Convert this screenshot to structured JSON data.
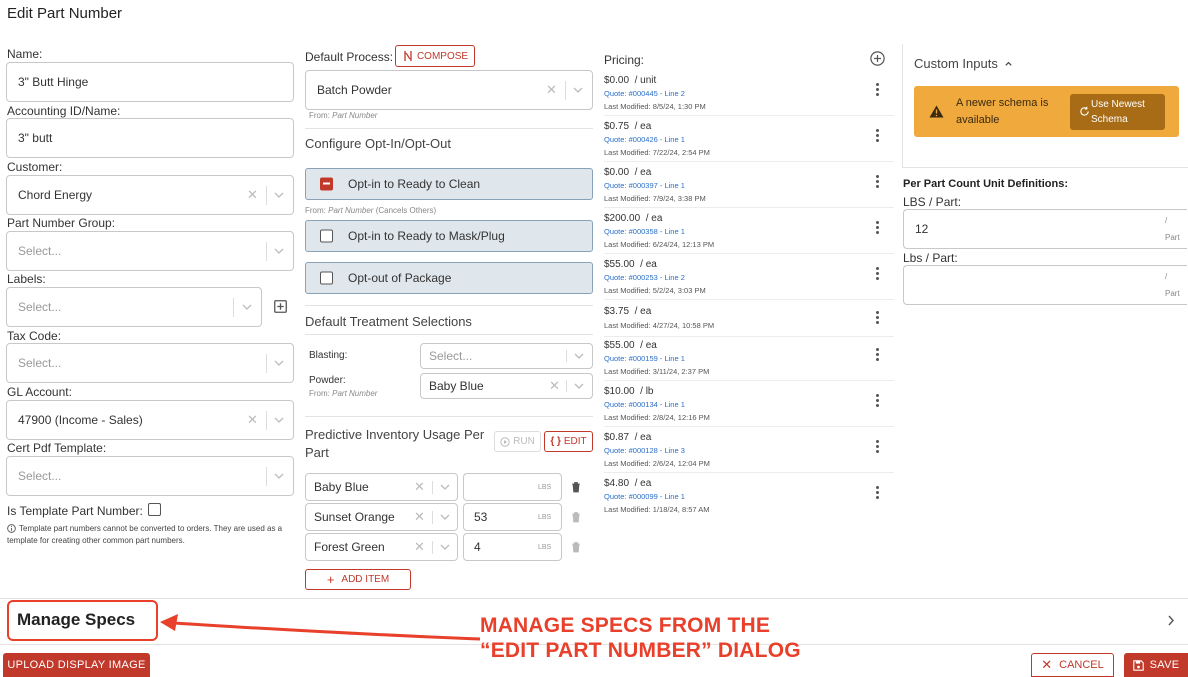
{
  "dialog": {
    "title": "Edit Part Number"
  },
  "left": {
    "name_label": "Name:",
    "name_value": "3\" Butt Hinge",
    "accounting_label": "Accounting ID/Name:",
    "accounting_value": "3\" butt",
    "customer_label": "Customer:",
    "customer_value": "Chord Energy",
    "group_label": "Part Number Group:",
    "group_placeholder": "Select...",
    "labels_label": "Labels:",
    "labels_placeholder": "Select...",
    "tax_label": "Tax Code:",
    "tax_placeholder": "Select...",
    "gl_label": "GL Account:",
    "gl_value": "47900 (Income - Sales)",
    "cert_label": "Cert Pdf Template:",
    "cert_placeholder": "Select...",
    "template_label": "Is Template Part Number:",
    "template_checked": false,
    "template_help": "Template part numbers cannot be converted to orders. They are used as a template for creating other common part numbers."
  },
  "middle": {
    "process_label": "Default Process:",
    "compose_label": "COMPOSE",
    "process_value": "Batch Powder",
    "process_from_prefix": "From:",
    "process_from_source": "Part Number",
    "optin_heading": "Configure Opt-In/Opt-Out",
    "options": [
      {
        "label": "Opt-in to Ready to Clean",
        "checked": true
      },
      {
        "label": "Opt-in to Ready to Mask/Plug",
        "checked": false
      },
      {
        "label": "Opt-out of Package",
        "checked": false
      }
    ],
    "option_from_prefix": "From:",
    "option_from_source": "Part Number",
    "option_from_note": "(Cancels Others)",
    "treatment_heading": "Default Treatment Selections",
    "blasting_label": "Blasting:",
    "blasting_placeholder": "Select...",
    "powder_label": "Powder:",
    "powder_value": "Baby Blue",
    "powder_from_prefix": "From:",
    "powder_from_source": "Part Number",
    "piu_heading_1": "Predictive Inventory Usage Per",
    "piu_heading_2": "Part",
    "run_label": "RUN",
    "edit_label": "EDIT",
    "inventory": [
      {
        "item": "Baby Blue",
        "qty": "",
        "unit": "LBS"
      },
      {
        "item": "Sunset Orange",
        "qty": "53",
        "unit": "LBS"
      },
      {
        "item": "Forest Green",
        "qty": "4",
        "unit": "LBS"
      }
    ],
    "add_item_label": "ADD ITEM"
  },
  "pricing": {
    "heading": "Pricing:",
    "rows": [
      {
        "price": "$0.00",
        "unit": "/ unit",
        "quote": "Quote: #000445 - Line 2",
        "modified": "Last Modified: 8/5/24, 1:30 PM"
      },
      {
        "price": "$0.75",
        "unit": "/ ea",
        "quote": "Quote: #000426 - Line 1",
        "modified": "Last Modified: 7/22/24, 2:54 PM"
      },
      {
        "price": "$0.00",
        "unit": "/ ea",
        "quote": "Quote: #000397 - Line 1",
        "modified": "Last Modified: 7/9/24, 3:38 PM"
      },
      {
        "price": "$200.00",
        "unit": "/ ea",
        "quote": "Quote: #000358 - Line 1",
        "modified": "Last Modified: 6/24/24, 12:13 PM"
      },
      {
        "price": "$55.00",
        "unit": "/ ea",
        "quote": "Quote: #000253 - Line 2",
        "modified": "Last Modified: 5/2/24, 3:03 PM"
      },
      {
        "price": "$3.75",
        "unit": "/ ea",
        "quote": "",
        "modified": "Last Modified: 4/27/24, 10:58 PM"
      },
      {
        "price": "$55.00",
        "unit": "/ ea",
        "quote": "Quote: #000159 - Line 1",
        "modified": "Last Modified: 3/11/24, 2:37 PM"
      },
      {
        "price": "$10.00",
        "unit": "/ lb",
        "quote": "Quote: #000134 - Line 1",
        "modified": "Last Modified: 2/8/24, 12:16 PM"
      },
      {
        "price": "$0.87",
        "unit": "/ ea",
        "quote": "Quote: #000128 - Line 3",
        "modified": "Last Modified: 2/6/24, 12:04 PM"
      },
      {
        "price": "$4.80",
        "unit": "/ ea",
        "quote": "Quote: #000099 - Line 1",
        "modified": "Last Modified: 1/18/24, 8:57 AM"
      }
    ]
  },
  "right": {
    "custom_inputs_heading": "Custom Inputs",
    "schema_notice": "A newer schema is available",
    "use_newest_label": "Use Newest Schema",
    "unit_defs_heading": "Per Part Count Unit Definitions:",
    "lbs_label": "LBS / Part:",
    "lbs_value": "12",
    "lbs2_label": "Lbs / Part:",
    "lbs2_value": "",
    "unit_suffix_slash": "/",
    "unit_suffix_part": "Part"
  },
  "footer": {
    "manage_specs": "Manage Specs",
    "upload_label": "UPLOAD DISPLAY IMAGE",
    "cancel_label": "CANCEL",
    "save_label": "SAVE"
  },
  "annotation": {
    "line1": "MANAGE SPECS FROM THE",
    "line2": "“EDIT PART NUMBER” DIALOG",
    "color": "#e8402b"
  },
  "colors": {
    "accent": "#c0392b",
    "warning": "#f0a93c",
    "link": "#2a6fc9"
  }
}
